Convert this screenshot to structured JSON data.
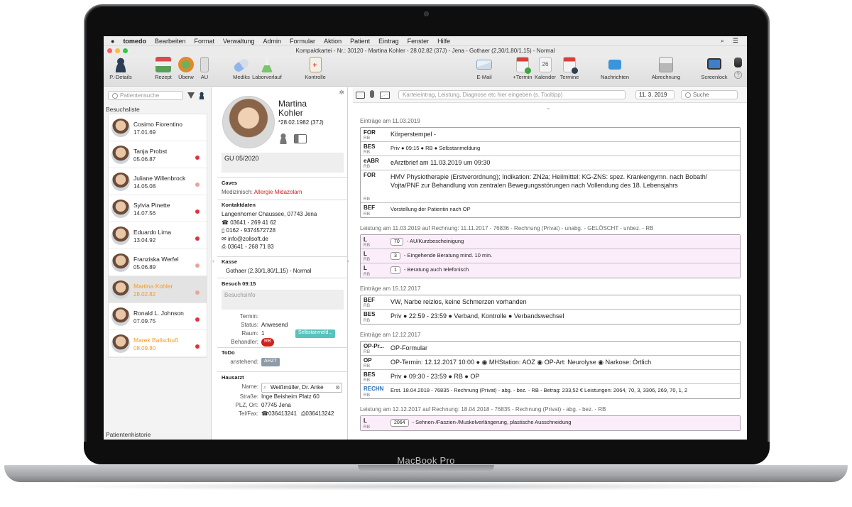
{
  "laptop_label": "MacBook Pro",
  "menu": {
    "app": "tomedo",
    "items": [
      "Bearbeiten",
      "Format",
      "Verwaltung",
      "Admin",
      "Formular",
      "Aktion",
      "Patient",
      "Eintrag",
      "Fenster",
      "Hilfe"
    ]
  },
  "window_title": "Kompaktkartei - Nr.: 30120 - Martina Kohler - 28.02.82 (37J) - Jena - Gothaer (2,30/1,80/1,15) - Normal",
  "toolbar": {
    "left": [
      "P.-Details",
      "Rezept",
      "Überw",
      "AU",
      "Mediks",
      "Laborverlauf",
      "Kontrolle"
    ],
    "right": [
      "E-Mail",
      "+Termin",
      "Kalender",
      "Termine",
      "Nachrichten",
      "Abrechnung",
      "Screenlock"
    ],
    "calendar_day": "26"
  },
  "sidebar": {
    "search_placeholder": "Patientensuche",
    "section": "Besuchsliste",
    "footer": "Patientenhistorie",
    "patients": [
      {
        "name": "Cosimo Fiorentino",
        "date": "17.01.69",
        "dot": "",
        "color": ""
      },
      {
        "name": "Tanja Probst",
        "date": "05.06.87",
        "dot": "#d9363e",
        "color": ""
      },
      {
        "name": "Juliane Willenbrock",
        "date": "14.05.08",
        "dot": "#e8a59a",
        "color": ""
      },
      {
        "name": "Sylvia Pinette",
        "date": "14.07.56",
        "dot": "#d9363e",
        "color": ""
      },
      {
        "name": "Eduardo Lima",
        "date": "13.04.92",
        "dot": "#d9363e",
        "color": ""
      },
      {
        "name": "Franziska Werfel",
        "date": "05.06.89",
        "dot": "#e8a59a",
        "color": ""
      },
      {
        "name": "Martina Kohler",
        "date": "28.02.82",
        "dot": "#e8a59a",
        "color": "orange"
      },
      {
        "name": "Ronald L. Johnson",
        "date": "07.09.75",
        "dot": "#d9363e",
        "color": ""
      },
      {
        "name": "Marek Ballschuß",
        "date": "08.09.80",
        "dot": "#d9363e",
        "color": "orange"
      }
    ]
  },
  "patient": {
    "first": "Martina",
    "last": "Kohler",
    "dob": "*28.02.1982 (37J)",
    "gu": "GU 05/2020",
    "caves_hd": "Caves",
    "caves_label": "Medizinisch:",
    "caves_value": "Allergie Midazolam",
    "kontakt_hd": "Kontaktdaten",
    "address": "Langenhorner Chaussee, 07743 Jena",
    "phone": "03641 - 269 41 62",
    "mobile": "0162 - 9374572728",
    "email": "info@zollsoft.de",
    "fax": "03641 - 268 71 83",
    "kasse_hd": "Kasse",
    "kasse": "Gothaer (2,30/1,80/1,15) - Normal",
    "besuch_hd": "Besuch 09:15",
    "besuchsinfo": "Besuchsinfo",
    "termin_k": "Termin:",
    "status_k": "Status:",
    "status_v": "Anwesend",
    "raum_k": "Raum:",
    "raum_v": "1",
    "raum_badge": "Selbstanmeld...",
    "behandler_k": "Behandler:",
    "behandler_v": "RB",
    "todo_hd": "ToDo",
    "anstehend_k": "anstehend:",
    "anstehend_v": "ARZT",
    "hausarzt_hd": "Hausarzt",
    "name_k": "Name:",
    "name_v": "Weißmüller, Dr. Anke",
    "strasse_k": "Straße:",
    "strasse_v": "Inge Beisheim Platz 60",
    "plz_k": "PLZ, Ort:",
    "plz_v": "07745 Jena",
    "tel_k": "Tel/Fax:",
    "tel_v": "036413241",
    "fax_v": "036413242"
  },
  "main": {
    "input_placeholder": "Karteieintrag, Leistung, Diagnose etc hier eingeben (s. Tooltipp)",
    "date": "11. 3. 2019",
    "search": "Suche",
    "groups": [
      {
        "title": "Einträge am 11.03.2019",
        "rows": [
          {
            "tag": "FOR",
            "rb": "RB",
            "text": "Körperstempel -",
            "pink": false,
            "num": "",
            "small": false
          },
          {
            "tag": "BES",
            "rb": "RB",
            "text": "Priv ● 09:15 ● RB ● Selbstanmeldung",
            "pink": false,
            "num": "",
            "small": true
          },
          {
            "tag": "eABR",
            "rb": "RB",
            "text": "eArztbrief am 11.03.2019 um 09:30",
            "pink": false,
            "num": "",
            "small": false
          },
          {
            "tag": "FOR",
            "rb": "RB",
            "text": "HMV Physiotherapie (Erstverordnung); Indikation: ZN2a; Heilmittel: KG-ZNS: spez. Krankengymn. nach Bobath/ Vojta/PNF zur Behandlung von zentralen Bewegungsstörungen nach Vollendung des 18. Lebensjahrs",
            "pink": false,
            "num": "",
            "small": false,
            "tall": true
          },
          {
            "tag": "BEF",
            "rb": "RB",
            "text": "Vorstellung der Patientin nach OP",
            "pink": false,
            "num": "",
            "small": true
          }
        ]
      },
      {
        "title": "Leistung am 11.03.2019 auf Rechnung: 11.11.2017 - 76836 - Rechnung (Privat) - unabg. - GELÖSCHT - unbez. - RB",
        "rows": [
          {
            "tag": "L",
            "rb": "RB",
            "text": "- AU/Kurzbescheinigung",
            "pink": true,
            "num": "70",
            "small": true
          },
          {
            "tag": "L",
            "rb": "RB",
            "text": "- Eingehende Beratung mind. 10 min.",
            "pink": true,
            "num": "3",
            "small": true
          },
          {
            "tag": "L",
            "rb": "RB",
            "text": "- Beratung auch telefonisch",
            "pink": true,
            "num": "1",
            "small": true
          }
        ]
      },
      {
        "title": "Einträge am 15.12.2017",
        "rows": [
          {
            "tag": "BEF",
            "rb": "RB",
            "text": "VW, Narbe reizlos, keine Schmerzen vorhanden",
            "pink": false,
            "num": "",
            "small": false
          },
          {
            "tag": "BES",
            "rb": "RB",
            "text": "Priv ● 22:59 - 23:59 ● Verband, Kontrolle ● Verbandswechsel",
            "pink": false,
            "num": "",
            "small": false
          }
        ]
      },
      {
        "title": "Einträge am 12.12.2017",
        "rows": [
          {
            "tag": "OP-Pr...",
            "rb": "RB",
            "text": "OP-Formular",
            "pink": false,
            "num": "",
            "small": false
          },
          {
            "tag": "OP",
            "rb": "RB",
            "text": "OP-Termin: 12.12.2017 10:00 ● ◉ MHStation: AOZ ◉ OP-Art: Neurolyse ◉ Narkose: Örtlich",
            "pink": false,
            "num": "",
            "small": false
          },
          {
            "tag": "BES",
            "rb": "RB",
            "text": "Priv ● 09:30 - 23:59 ● RB ● OP",
            "pink": false,
            "num": "",
            "small": false
          },
          {
            "tag": "RECHN",
            "rb": "RB",
            "text": "Erst. 18.04.2018 - 76835 - Rechnung (Privat) - abg. - bez. - RB - Betrag: 233,52 € Leistungen: 2064, 70, 3, 3306, 269, 70, 1, 2",
            "pink": false,
            "num": "",
            "small": true,
            "rechn": true
          }
        ]
      },
      {
        "title": "Leistung am 12.12.2017 auf Rechnung: 18.04.2018 - 76835 - Rechnung (Privat) - abg. - bez. - RB",
        "rows": [
          {
            "tag": "L",
            "rb": "RB",
            "text": "- Sehnen-/Faszien-/Muskelverlängerung, plastische Ausschneidung",
            "pink": true,
            "num": "2064",
            "small": true
          }
        ]
      }
    ]
  }
}
